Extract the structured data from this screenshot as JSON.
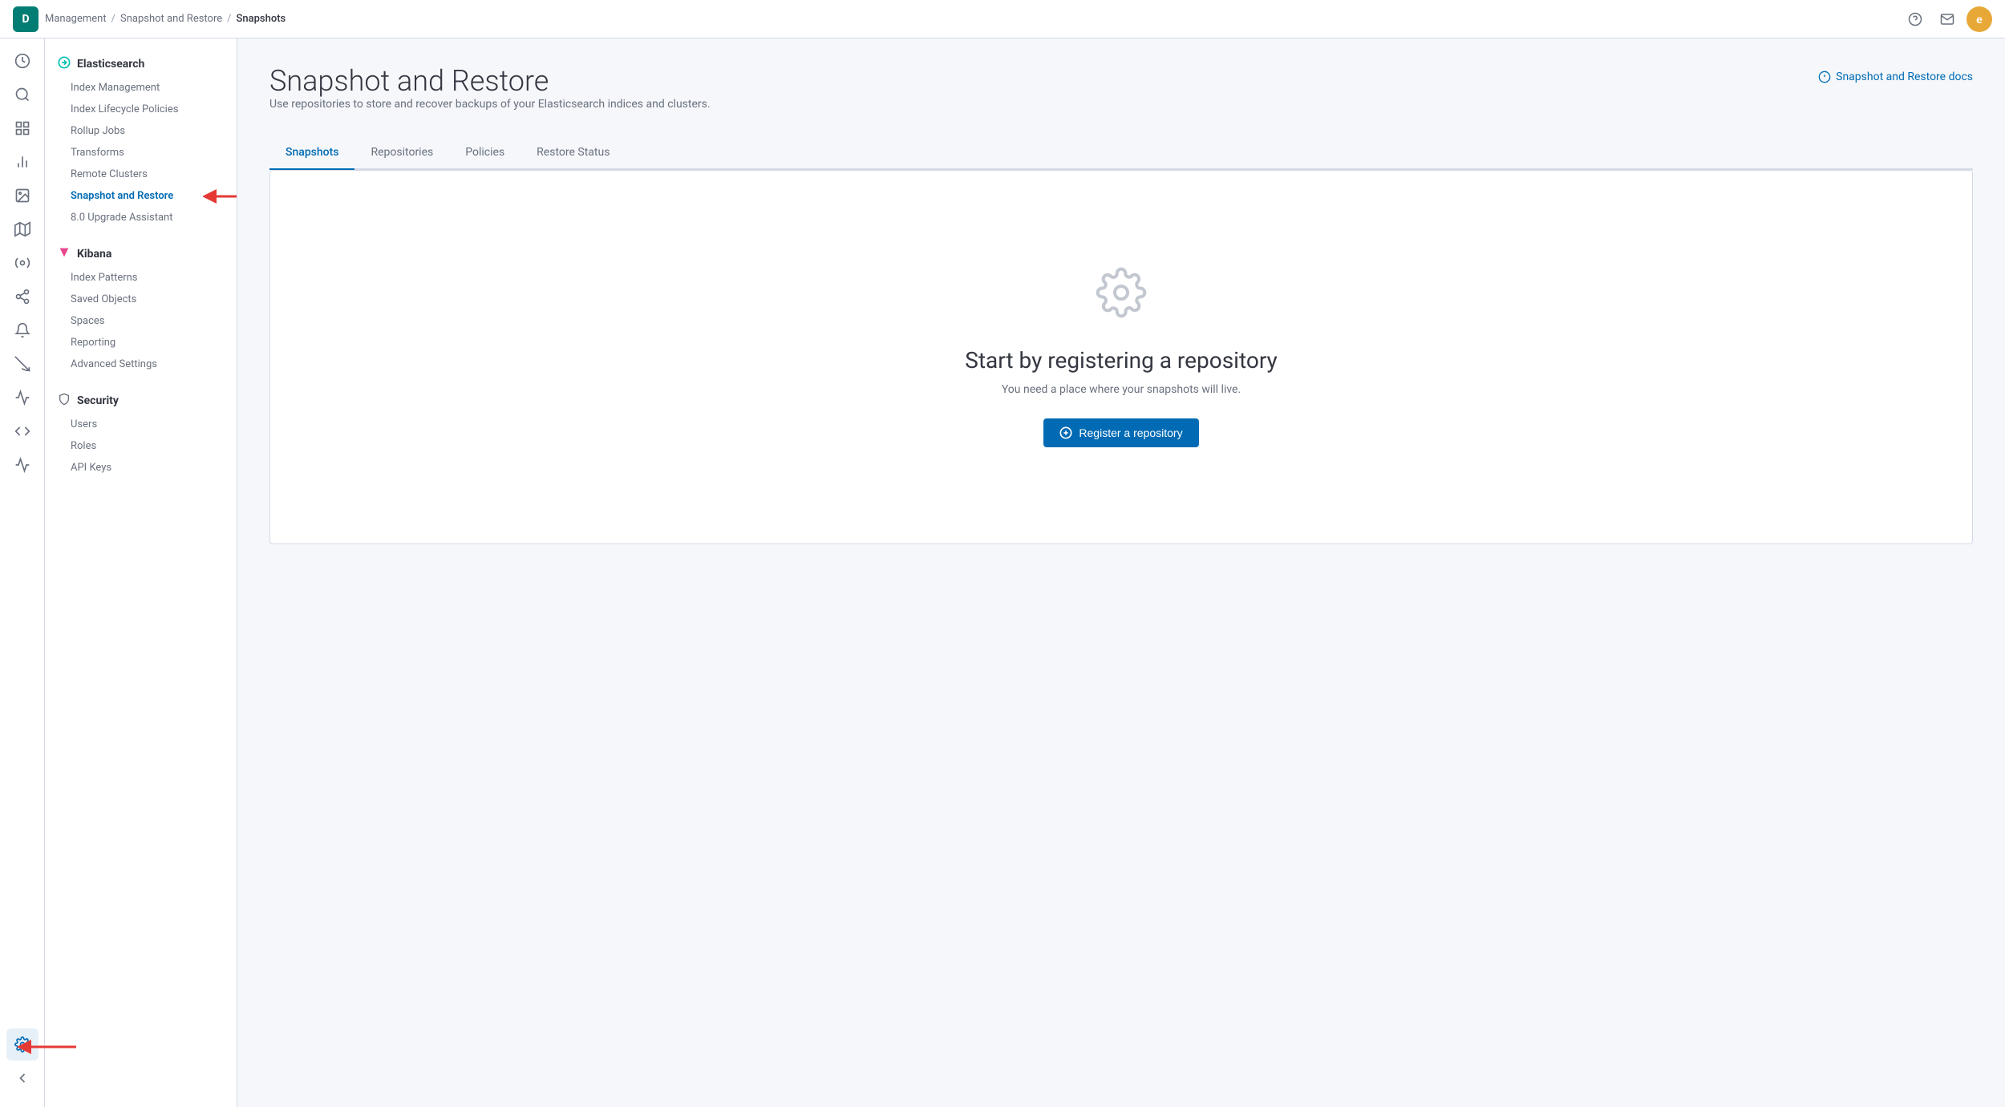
{
  "topnav": {
    "logo_letter": "D",
    "breadcrumbs": [
      {
        "label": "Management",
        "href": "#"
      },
      {
        "label": "Snapshot and Restore",
        "href": "#"
      },
      {
        "label": "Snapshots",
        "current": true
      }
    ]
  },
  "sidebar": {
    "sections": [
      {
        "id": "elasticsearch",
        "icon": "⚡",
        "label": "Elasticsearch",
        "items": [
          {
            "id": "index-management",
            "label": "Index Management",
            "active": false
          },
          {
            "id": "index-lifecycle-policies",
            "label": "Index Lifecycle Policies",
            "active": false
          },
          {
            "id": "rollup-jobs",
            "label": "Rollup Jobs",
            "active": false
          },
          {
            "id": "transforms",
            "label": "Transforms",
            "active": false
          },
          {
            "id": "remote-clusters",
            "label": "Remote Clusters",
            "active": false
          },
          {
            "id": "snapshot-and-restore",
            "label": "Snapshot and Restore",
            "active": true
          },
          {
            "id": "upgrade-assistant",
            "label": "8.0 Upgrade Assistant",
            "active": false
          }
        ]
      },
      {
        "id": "kibana",
        "icon": "🔷",
        "label": "Kibana",
        "items": [
          {
            "id": "index-patterns",
            "label": "Index Patterns",
            "active": false
          },
          {
            "id": "saved-objects",
            "label": "Saved Objects",
            "active": false
          },
          {
            "id": "spaces",
            "label": "Spaces",
            "active": false
          },
          {
            "id": "reporting",
            "label": "Reporting",
            "active": false
          },
          {
            "id": "advanced-settings",
            "label": "Advanced Settings",
            "active": false
          }
        ]
      },
      {
        "id": "security",
        "icon": "🛡",
        "label": "Security",
        "items": [
          {
            "id": "users",
            "label": "Users",
            "active": false
          },
          {
            "id": "roles",
            "label": "Roles",
            "active": false
          },
          {
            "id": "api-keys",
            "label": "API Keys",
            "active": false
          }
        ]
      }
    ]
  },
  "page": {
    "title": "Snapshot and Restore",
    "subtitle": "Use repositories to store and recover backups of your Elasticsearch indices and clusters.",
    "docs_link": "Snapshot and Restore docs"
  },
  "tabs": [
    {
      "id": "snapshots",
      "label": "Snapshots",
      "active": true
    },
    {
      "id": "repositories",
      "label": "Repositories",
      "active": false
    },
    {
      "id": "policies",
      "label": "Policies",
      "active": false
    },
    {
      "id": "restore-status",
      "label": "Restore Status",
      "active": false
    }
  ],
  "empty_state": {
    "title": "Start by registering a repository",
    "description": "You need a place where your snapshots will live.",
    "button_label": "Register a repository"
  },
  "rail_icons": [
    {
      "id": "clock",
      "symbol": "🕐",
      "label": "Recently viewed"
    },
    {
      "id": "search",
      "symbol": "🔍",
      "label": "Search"
    },
    {
      "id": "dashboard",
      "symbol": "📊",
      "label": "Dashboard"
    },
    {
      "id": "visualize",
      "symbol": "📈",
      "label": "Visualize"
    },
    {
      "id": "canvas",
      "symbol": "🖼",
      "label": "Canvas"
    },
    {
      "id": "maps",
      "symbol": "🗺",
      "label": "Maps"
    },
    {
      "id": "ml",
      "symbol": "⚙",
      "label": "Machine Learning"
    },
    {
      "id": "graph",
      "symbol": "🔗",
      "label": "Graph"
    },
    {
      "id": "alerting",
      "symbol": "🔔",
      "label": "Alerting"
    },
    {
      "id": "apm",
      "symbol": "📡",
      "label": "APM"
    },
    {
      "id": "uptime",
      "symbol": "💓",
      "label": "Uptime"
    },
    {
      "id": "dev-tools",
      "symbol": "🔧",
      "label": "Dev Tools"
    },
    {
      "id": "stack-monitoring",
      "symbol": "🗃",
      "label": "Stack Monitoring"
    },
    {
      "id": "management",
      "symbol": "⚙",
      "label": "Management",
      "active": true
    }
  ]
}
